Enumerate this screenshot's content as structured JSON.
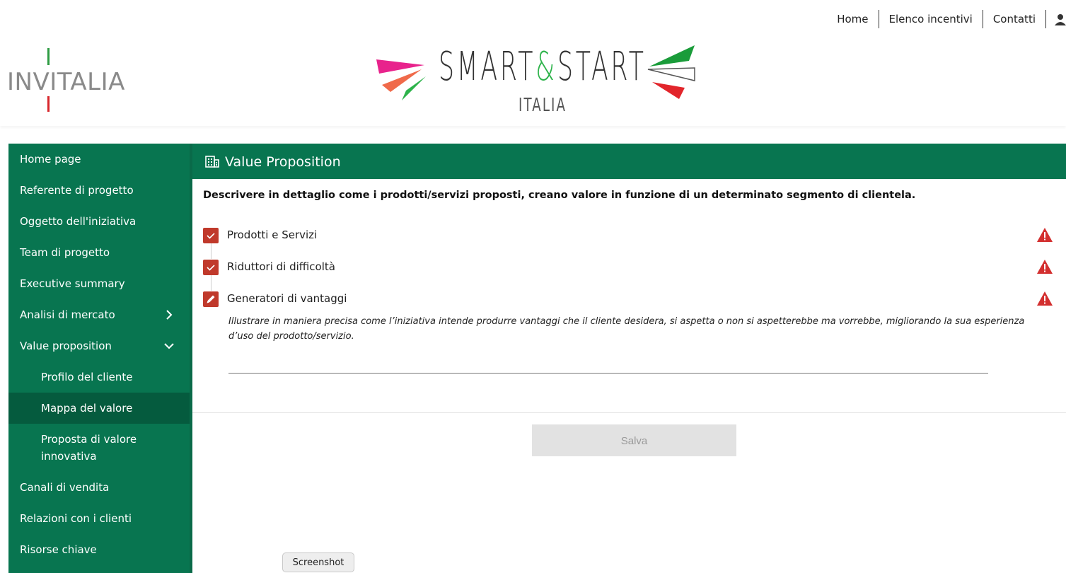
{
  "topnav": {
    "links": [
      "Home",
      "Elenco incentivi",
      "Contatti"
    ],
    "user_icon": "user-icon"
  },
  "brand": {
    "left_logo": "INVITALIA",
    "main_logo_title": "SMART&START",
    "main_logo_amp": "&",
    "main_logo_subtitle": "ITALIA"
  },
  "sidebar": {
    "items": [
      {
        "label": "Home page"
      },
      {
        "label": "Referente di progetto"
      },
      {
        "label": "Oggetto dell'iniziativa"
      },
      {
        "label": "Team di progetto"
      },
      {
        "label": "Executive summary"
      },
      {
        "label": "Analisi di mercato",
        "icon": "chevron-right-icon"
      },
      {
        "label": "Value proposition",
        "icon": "chevron-down-icon"
      },
      {
        "label": "Profilo del cliente"
      },
      {
        "label": "Mappa del valore",
        "active": true
      },
      {
        "label": "Proposta di valore innovativa"
      },
      {
        "label": "Canali di vendita"
      },
      {
        "label": "Relazioni con i clienti"
      },
      {
        "label": "Risorse chiave"
      }
    ]
  },
  "panel": {
    "title": "Value Proposition",
    "icon": "building-icon",
    "description": "Descrivere in dettaglio come i prodotti/servizi proposti, creano valore in funzione di un determinato segmento di clientela.",
    "steps": [
      {
        "label": "Prodotti e Servizi",
        "state": "completed",
        "icon": "check-icon"
      },
      {
        "label": "Riduttori di difficoltà",
        "state": "completed",
        "icon": "check-icon"
      },
      {
        "label": "Generatori di vantaggi",
        "state": "editing",
        "icon": "pencil-icon"
      }
    ],
    "hint": "Illustrare in maniera precisa come l’iniziativa intende produrre vantaggi che il cliente desidera, si aspetta o non si aspetterebbe ma vorrebbe, migliorando la sua esperienza d’uso del prodotto/servizio.",
    "save_label": "Salva"
  },
  "overlay": {
    "screenshot_label": "Screenshot"
  },
  "colors": {
    "primary_green": "#087550",
    "active_green": "#055b3e",
    "step_red": "#c0392b",
    "warning_red": "#d32f2f"
  }
}
